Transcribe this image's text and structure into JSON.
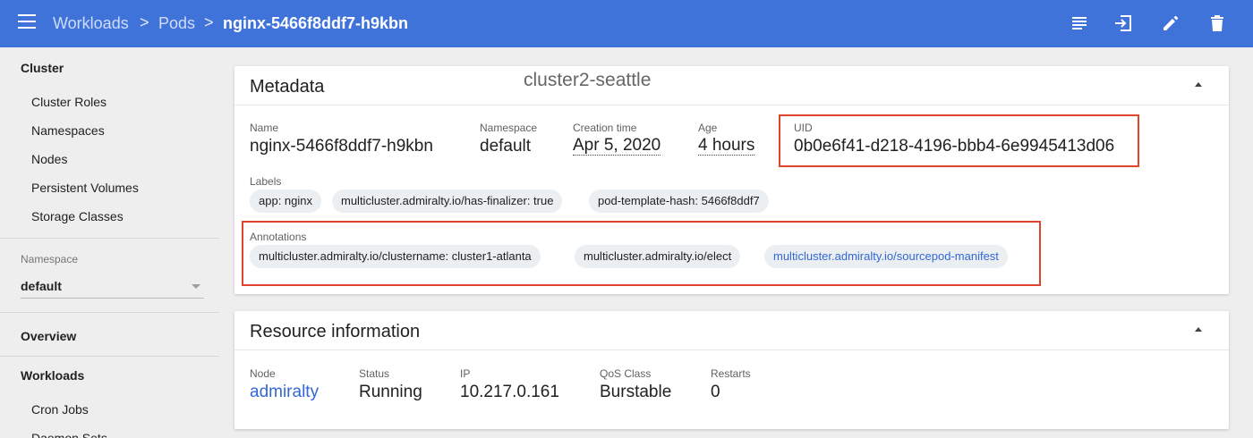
{
  "topbar": {
    "breadcrumbs": [
      "Workloads",
      "Pods",
      "nginx-5466f8ddf7-h9kbn"
    ],
    "separators": [
      ">",
      ">"
    ],
    "actions": [
      "logs-icon",
      "exec-icon",
      "edit-icon",
      "delete-icon"
    ]
  },
  "sidebar": {
    "cluster_heading": "Cluster",
    "cluster_items": [
      "Cluster Roles",
      "Namespaces",
      "Nodes",
      "Persistent Volumes",
      "Storage Classes"
    ],
    "namespace_label": "Namespace",
    "namespace_value": "default",
    "overview": "Overview",
    "workloads_heading": "Workloads",
    "workload_items": [
      "Cron Jobs",
      "Daemon Sets"
    ]
  },
  "metadata": {
    "title": "Metadata",
    "overlay_label": "cluster2-seattle",
    "name_label": "Name",
    "name_value": "nginx-5466f8ddf7-h9kbn",
    "namespace_label": "Namespace",
    "namespace_value": "default",
    "creation_label": "Creation time",
    "creation_value": "Apr 5, 2020",
    "age_label": "Age",
    "age_value": "4 hours",
    "uid_label": "UID",
    "uid_value": "0b0e6f41-d218-4196-bbb4-6e9945413d06",
    "labels_label": "Labels",
    "labels": [
      "app: nginx",
      "multicluster.admiralty.io/has-finalizer: true",
      "pod-template-hash: 5466f8ddf7"
    ],
    "annotations_label": "Annotations",
    "annotations": [
      "multicluster.admiralty.io/clustername: cluster1-atlanta",
      "multicluster.admiralty.io/elect",
      "multicluster.admiralty.io/sourcepod-manifest"
    ]
  },
  "resource": {
    "title": "Resource information",
    "node_label": "Node",
    "node_value": "admiralty",
    "status_label": "Status",
    "status_value": "Running",
    "ip_label": "IP",
    "ip_value": "10.217.0.161",
    "qos_label": "QoS Class",
    "qos_value": "Burstable",
    "restarts_label": "Restarts",
    "restarts_value": "0"
  },
  "colors": {
    "topbar": "#3f73da",
    "link": "#3367d6",
    "highlight_box": "#e0452e"
  }
}
